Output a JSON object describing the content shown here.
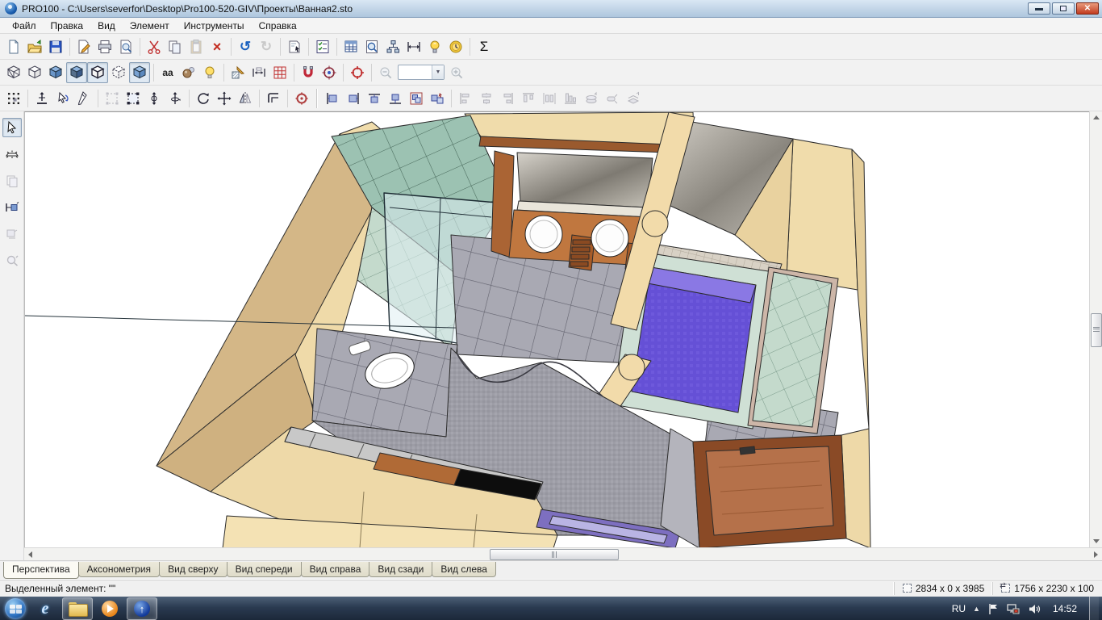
{
  "window": {
    "title": "PRO100 - C:\\Users\\severfor\\Desktop\\Pro100-520-GIV\\Проекты\\Ванная2.sto"
  },
  "menu": {
    "items": [
      "Файл",
      "Правка",
      "Вид",
      "Элемент",
      "Инструменты",
      "Справка"
    ]
  },
  "toolbar": {
    "zoom_value": "",
    "icons": {
      "delete": "×",
      "undo": "↺",
      "redo": "↻",
      "sigma": "Σ",
      "labels": "aa",
      "dropdown": "▼"
    }
  },
  "view_tabs": {
    "active": "Перспектива",
    "items": [
      "Перспектива",
      "Аксонометрия",
      "Вид сверху",
      "Вид спереди",
      "Вид справа",
      "Вид сзади",
      "Вид слева"
    ]
  },
  "statusbar": {
    "selected_element_label": "Выделенный элемент: \"\"",
    "position_dimensions": "2834 x 0 x 3985",
    "size_dimensions": "1756 x 2230 x 100"
  },
  "taskbar": {
    "language": "RU",
    "tray_expand": "▲",
    "time": "14:52"
  }
}
